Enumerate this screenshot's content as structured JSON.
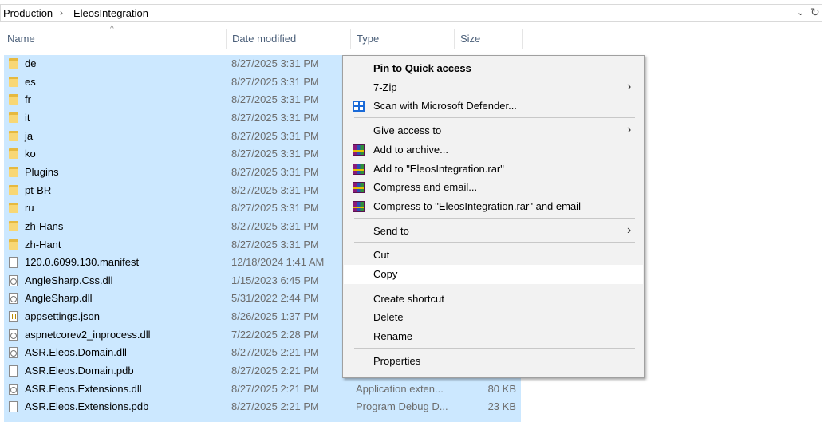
{
  "address": {
    "breadcrumbs": [
      "Production",
      "EleosIntegration"
    ],
    "separator": "›",
    "dropdown_glyph": "⌄",
    "refresh_glyph": "↻"
  },
  "columns": {
    "name": "Name",
    "date": "Date modified",
    "type": "Type",
    "size": "Size",
    "sort_glyph": "^"
  },
  "files": [
    {
      "name": "de",
      "date": "8/27/2025 3:31 PM",
      "type": "",
      "size": "",
      "icon": "folder-icon"
    },
    {
      "name": "es",
      "date": "8/27/2025 3:31 PM",
      "type": "",
      "size": "",
      "icon": "folder-icon"
    },
    {
      "name": "fr",
      "date": "8/27/2025 3:31 PM",
      "type": "",
      "size": "",
      "icon": "folder-icon"
    },
    {
      "name": "it",
      "date": "8/27/2025 3:31 PM",
      "type": "",
      "size": "",
      "icon": "folder-icon"
    },
    {
      "name": "ja",
      "date": "8/27/2025 3:31 PM",
      "type": "",
      "size": "",
      "icon": "folder-icon"
    },
    {
      "name": "ko",
      "date": "8/27/2025 3:31 PM",
      "type": "",
      "size": "",
      "icon": "folder-icon"
    },
    {
      "name": "Plugins",
      "date": "8/27/2025 3:31 PM",
      "type": "",
      "size": "",
      "icon": "folder-icon"
    },
    {
      "name": "pt-BR",
      "date": "8/27/2025 3:31 PM",
      "type": "",
      "size": "",
      "icon": "folder-icon"
    },
    {
      "name": "ru",
      "date": "8/27/2025 3:31 PM",
      "type": "",
      "size": "",
      "icon": "folder-icon"
    },
    {
      "name": "zh-Hans",
      "date": "8/27/2025 3:31 PM",
      "type": "",
      "size": "",
      "icon": "folder-icon"
    },
    {
      "name": "zh-Hant",
      "date": "8/27/2025 3:31 PM",
      "type": "",
      "size": "",
      "icon": "folder-icon"
    },
    {
      "name": "120.0.6099.130.manifest",
      "date": "12/18/2024 1:41 AM",
      "type": "",
      "size": "",
      "icon": "document-icon"
    },
    {
      "name": "AngleSharp.Css.dll",
      "date": "1/15/2023 6:45 PM",
      "type": "",
      "size": "",
      "icon": "dll-icon"
    },
    {
      "name": "AngleSharp.dll",
      "date": "5/31/2022 2:44 PM",
      "type": "",
      "size": "",
      "icon": "dll-icon"
    },
    {
      "name": "appsettings.json",
      "date": "8/26/2025 1:37 PM",
      "type": "",
      "size": "",
      "icon": "json-icon"
    },
    {
      "name": "aspnetcorev2_inprocess.dll",
      "date": "7/22/2025 2:28 PM",
      "type": "",
      "size": "",
      "icon": "dll-icon"
    },
    {
      "name": "ASR.Eleos.Domain.dll",
      "date": "8/27/2025 2:21 PM",
      "type": "",
      "size": "",
      "icon": "dll-icon"
    },
    {
      "name": "ASR.Eleos.Domain.pdb",
      "date": "8/27/2025 2:21 PM",
      "type": "",
      "size": "",
      "icon": "document-icon"
    },
    {
      "name": "ASR.Eleos.Extensions.dll",
      "date": "8/27/2025 2:21 PM",
      "type": "Application exten...",
      "size": "80 KB",
      "icon": "dll-icon"
    },
    {
      "name": "ASR.Eleos.Extensions.pdb",
      "date": "8/27/2025 2:21 PM",
      "type": "Program Debug D...",
      "size": "23 KB",
      "icon": "document-icon"
    }
  ],
  "menu": [
    {
      "label": "Pin to Quick access",
      "bold": true,
      "submenu": false,
      "icon": "",
      "hover": false
    },
    {
      "label": "7-Zip",
      "bold": false,
      "submenu": true,
      "icon": "",
      "hover": false
    },
    {
      "label": "Scan with Microsoft Defender...",
      "bold": false,
      "submenu": false,
      "icon": "defender-icon",
      "hover": false
    },
    {
      "sep": true
    },
    {
      "label": "Give access to",
      "bold": false,
      "submenu": true,
      "icon": "",
      "hover": false
    },
    {
      "label": "Add to archive...",
      "bold": false,
      "submenu": false,
      "icon": "winrar-icon",
      "hover": false
    },
    {
      "label": "Add to \"EleosIntegration.rar\"",
      "bold": false,
      "submenu": false,
      "icon": "winrar-icon",
      "hover": false
    },
    {
      "label": "Compress and email...",
      "bold": false,
      "submenu": false,
      "icon": "winrar-icon",
      "hover": false
    },
    {
      "label": "Compress to \"EleosIntegration.rar\" and email",
      "bold": false,
      "submenu": false,
      "icon": "winrar-icon",
      "hover": false
    },
    {
      "sep": true
    },
    {
      "label": "Send to",
      "bold": false,
      "submenu": true,
      "icon": "",
      "hover": false
    },
    {
      "sep": true
    },
    {
      "label": "Cut",
      "bold": false,
      "submenu": false,
      "icon": "",
      "hover": false
    },
    {
      "label": "Copy",
      "bold": false,
      "submenu": false,
      "icon": "",
      "hover": true
    },
    {
      "sep": true
    },
    {
      "label": "Create shortcut",
      "bold": false,
      "submenu": false,
      "icon": "",
      "hover": false
    },
    {
      "label": "Delete",
      "bold": false,
      "submenu": false,
      "icon": "",
      "hover": false
    },
    {
      "label": "Rename",
      "bold": false,
      "submenu": false,
      "icon": "",
      "hover": false
    },
    {
      "sep": true
    },
    {
      "label": "Properties",
      "bold": false,
      "submenu": false,
      "icon": "",
      "hover": false
    }
  ],
  "submenu_arrow": "›",
  "colors": {
    "selection": "#cce8ff",
    "menu_bg": "#f2f2f2",
    "menu_hover": "#ffffff",
    "header_text": "#4c607a",
    "detail_text": "#6d6d6d"
  }
}
